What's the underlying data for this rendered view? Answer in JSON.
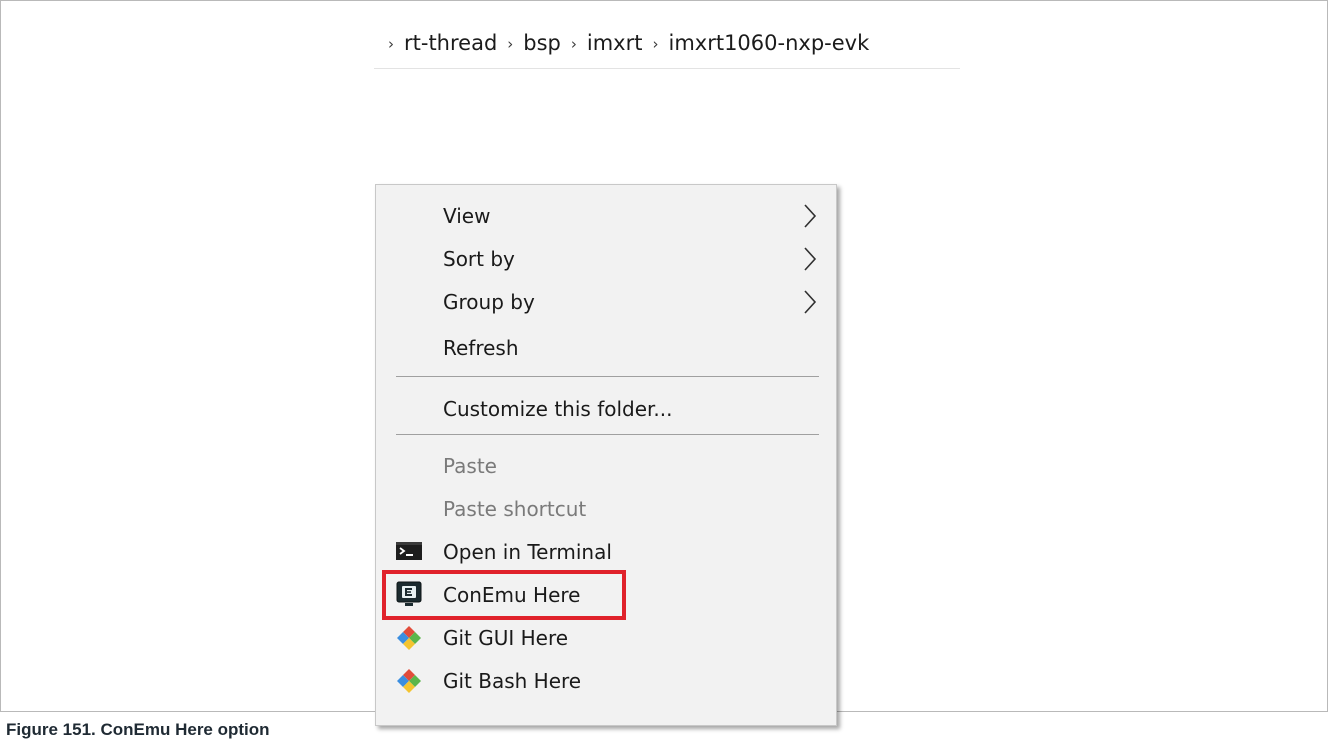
{
  "breadcrumb": {
    "items": [
      "rt-thread",
      "bsp",
      "imxrt",
      "imxrt1060-nxp-evk"
    ],
    "separator": "›"
  },
  "context_menu": {
    "items": [
      {
        "label": "View",
        "submenu": true,
        "enabled": true
      },
      {
        "label": "Sort by",
        "submenu": true,
        "enabled": true
      },
      {
        "label": "Group by",
        "submenu": true,
        "enabled": true
      },
      {
        "label": "Refresh",
        "enabled": true
      },
      {
        "label": "Customize this folder...",
        "enabled": true
      },
      {
        "label": "Paste",
        "enabled": false
      },
      {
        "label": "Paste shortcut",
        "enabled": false
      },
      {
        "label": "Open in Terminal",
        "icon": "terminal-icon",
        "enabled": true
      },
      {
        "label": "ConEmu Here",
        "icon": "conemu-icon",
        "enabled": true,
        "highlighted": true
      },
      {
        "label": "Git GUI Here",
        "icon": "git-gui-icon",
        "enabled": true
      },
      {
        "label": "Git Bash Here",
        "icon": "git-bash-icon",
        "enabled": true
      }
    ]
  },
  "colors": {
    "highlight_border": "#e0222b",
    "menu_background": "#f2f2f2"
  },
  "caption": "Figure 151.  ConEmu Here option"
}
